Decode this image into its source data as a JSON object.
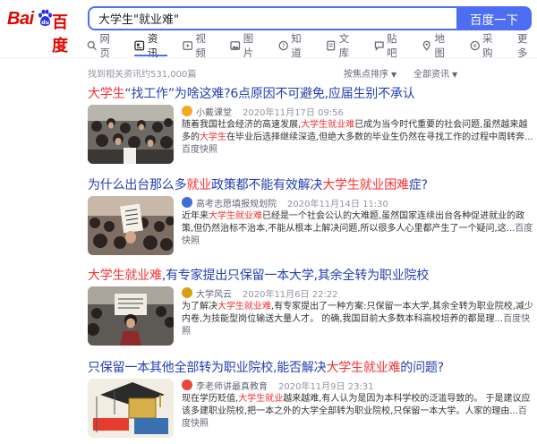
{
  "logo": {
    "text_left": "Bai",
    "text_right": "百度"
  },
  "search": {
    "query": "大学生\"就业难\"",
    "button_label": "百度一下"
  },
  "tabs": [
    {
      "label": "网页",
      "icon": "web-icon"
    },
    {
      "label": "资讯",
      "icon": "news-icon",
      "active": true
    },
    {
      "label": "视频",
      "icon": "video-icon"
    },
    {
      "label": "图片",
      "icon": "image-icon"
    },
    {
      "label": "知道",
      "icon": "question-icon"
    },
    {
      "label": "文库",
      "icon": "document-icon"
    },
    {
      "label": "贴吧",
      "icon": "tieba-icon"
    },
    {
      "label": "地图",
      "icon": "map-icon"
    },
    {
      "label": "采购",
      "icon": "purchase-icon"
    },
    {
      "label": "更多"
    }
  ],
  "meta": {
    "found": "找到相关资讯约531,000篇",
    "sort_label": "按焦点排序",
    "filter_label": "全部资讯"
  },
  "colors": {
    "accent": "#4e6ef2",
    "link": "#2440b3",
    "highlight": "#f73131",
    "logo_red": "#e10601"
  },
  "results": [
    {
      "title": [
        {
          "t": "大学生",
          "hl": true
        },
        {
          "t": "“找工作”为啥这难?6点原因不可避免,应届生别不承认"
        }
      ],
      "source": "小戴课堂",
      "time": "2020年11月17日 09:56",
      "source_icon_color": "#f5a623",
      "snippet": [
        {
          "t": "随着我国社会经济的高速发展,"
        },
        {
          "t": "大学生就业难",
          "hl": true
        },
        {
          "t": "已成为当今时代重要的社会问题,虽然越来越多的"
        },
        {
          "t": "大学生",
          "hl": true
        },
        {
          "t": "在毕业后选择继续深造,但绝大多数的毕业生仍然在寻找工作的过程中周转奔..."
        },
        {
          "t": "百度快照",
          "snap": true
        }
      ]
    },
    {
      "title": [
        {
          "t": "为什么出台那么多"
        },
        {
          "t": "就业",
          "hl": true
        },
        {
          "t": "政策都不能有效解决"
        },
        {
          "t": "大学生就业困难",
          "hl": true
        },
        {
          "t": "症?"
        }
      ],
      "source": "高考志愿填报规划院",
      "time": "2020年11月14日 11:30",
      "source_icon_color": "#3d6fd6",
      "snippet": [
        {
          "t": "近年来"
        },
        {
          "t": "大学生就业难",
          "hl": true
        },
        {
          "t": "已经是一个社会公认的大难题,虽然国家连续出台各种促进就业的政策,但仍然治标不治本,不能从根本上解决问题,所以很多人心里都产生了一个疑问,这..."
        },
        {
          "t": "百度快照",
          "snap": true
        }
      ]
    },
    {
      "title": [
        {
          "t": "大学生就业难",
          "hl": true
        },
        {
          "t": ",有专家提出只保留一本大学,其余全转为职业院校"
        }
      ],
      "source": "大学风云",
      "time": "2020年11月6日 22:22",
      "source_icon_color": "#d4a017",
      "snippet": [
        {
          "t": "为了解决"
        },
        {
          "t": "大学生就业难",
          "hl": true
        },
        {
          "t": ",有专家提出了一种方案:只保留一本大学,其余全转为职业院校,减少内卷,为技能型岗位输送大量人才。 的确,我国目前大多数本科高校培养的都是理..."
        },
        {
          "t": "百度快照",
          "snap": true
        }
      ]
    },
    {
      "title": [
        {
          "t": "只保留一本其他全部转为职业院校,能否解决"
        },
        {
          "t": "大学生就业难",
          "hl": true
        },
        {
          "t": "的问题?"
        }
      ],
      "source": "李老师讲最真教育",
      "time": "2020年11月9日 23:31",
      "source_icon_color": "#e8453c",
      "snippet": [
        {
          "t": "现在学历贬值,"
        },
        {
          "t": "大学生就业",
          "hl": true
        },
        {
          "t": "越来越难,有人认为是因为本科学校的泛滥导致的。 于是建议应该多建职业院校,把一本之外的大学全部转为职业院校,只保留一本大学。人家的理由..."
        },
        {
          "t": "百度快照",
          "snap": true
        }
      ]
    }
  ]
}
